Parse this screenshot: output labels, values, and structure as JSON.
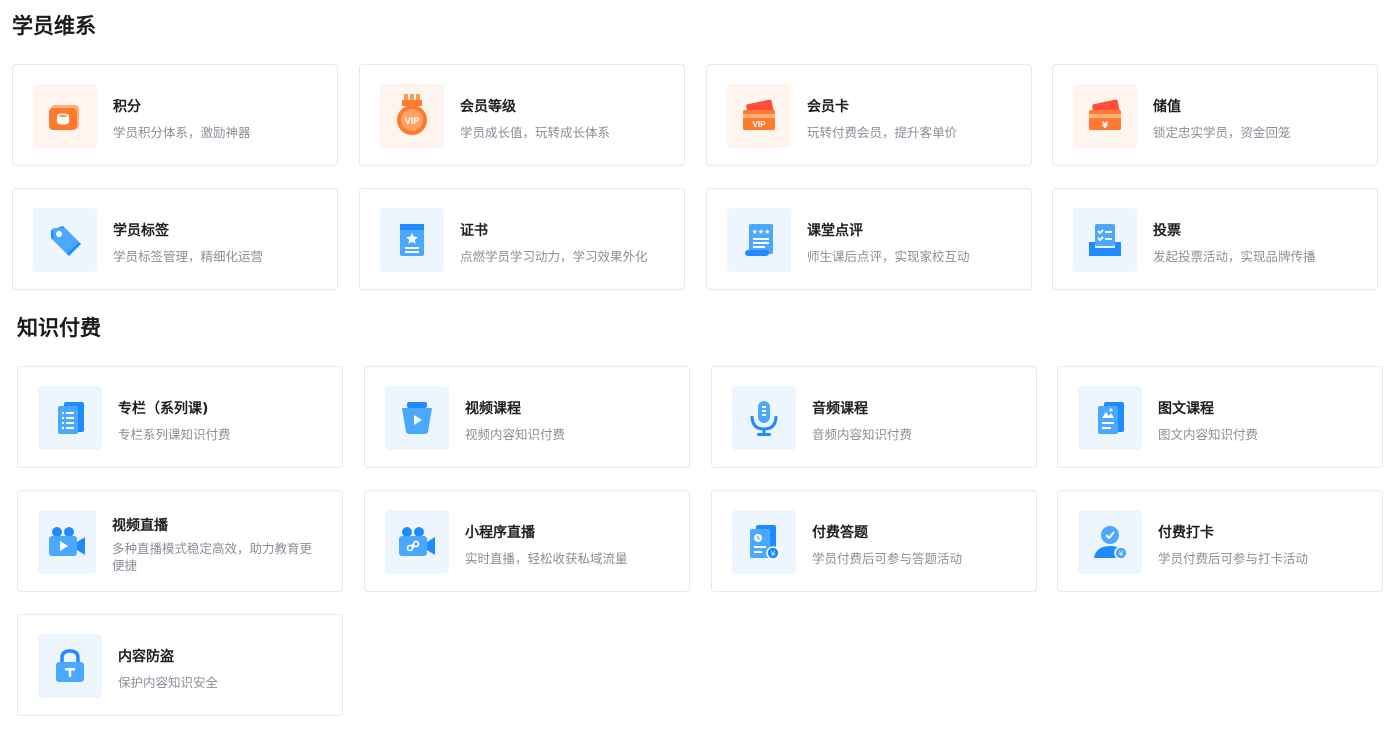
{
  "sections": [
    {
      "title": "学员维系",
      "cards": [
        {
          "title": "积分",
          "desc": "学员积分体系，激励神器"
        },
        {
          "title": "会员等级",
          "desc": "学员成长值，玩转成长体系"
        },
        {
          "title": "会员卡",
          "desc": "玩转付费会员，提升客单价"
        },
        {
          "title": "储值",
          "desc": "锁定忠实学员，资金回笼"
        },
        {
          "title": "学员标签",
          "desc": "学员标签管理，精细化运营"
        },
        {
          "title": "证书",
          "desc": "点燃学员学习动力，学习效果外化"
        },
        {
          "title": "课堂点评",
          "desc": "师生课后点评，实现家校互动"
        },
        {
          "title": "投票",
          "desc": "发起投票活动，实现品牌传播"
        }
      ]
    },
    {
      "title": "知识付费",
      "cards": [
        {
          "title": "专栏（系列课)",
          "desc": "专栏系列课知识付费"
        },
        {
          "title": "视频课程",
          "desc": "视频内容知识付费"
        },
        {
          "title": "音频课程",
          "desc": "音频内容知识付费"
        },
        {
          "title": "图文课程",
          "desc": "图文内容知识付费"
        },
        {
          "title": "视频直播",
          "desc": "多种直播模式稳定高效，助力教育更便捷"
        },
        {
          "title": "小程序直播",
          "desc": "实时直播，轻松收获私域流量"
        },
        {
          "title": "付费答题",
          "desc": "学员付费后可参与答题活动"
        },
        {
          "title": "付费打卡",
          "desc": "学员付费后可参与打卡活动"
        },
        {
          "title": "内容防盗",
          "desc": "保护内容知识安全"
        }
      ]
    }
  ],
  "icons": {
    "0": [
      "coins-icon",
      "vip-medal-icon",
      "vip-card-icon",
      "stored-value-card-icon",
      "tag-icon",
      "certificate-icon",
      "review-scroll-icon",
      "vote-icon"
    ],
    "1": [
      "column-book-icon",
      "video-play-icon",
      "microphone-icon",
      "image-text-icon",
      "video-camera-icon",
      "mini-program-live-icon",
      "paid-quiz-icon",
      "paid-checkin-icon",
      "lock-icon"
    ]
  },
  "colors": {
    "orange_icon": "#ff7a2f",
    "orange_bg": "#fff4ee",
    "blue_icon": "#1f8bff",
    "blue_bg": "#edf6ff"
  }
}
